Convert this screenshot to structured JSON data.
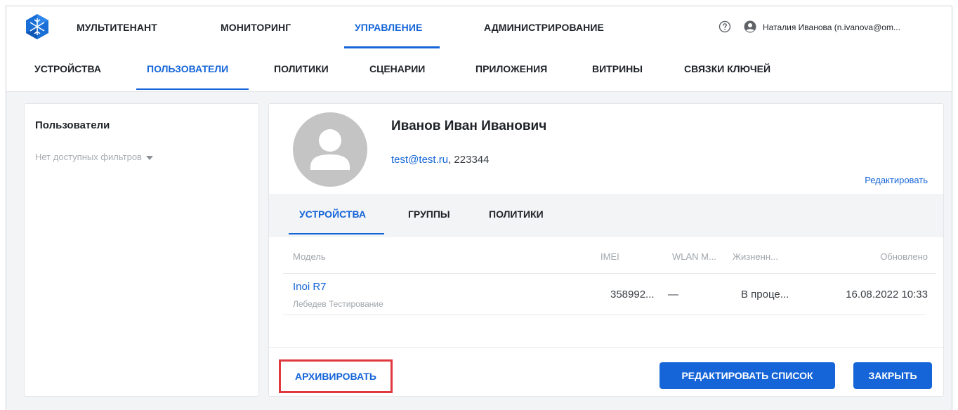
{
  "topnav": {
    "items": [
      "МУЛЬТИТЕНАНТ",
      "МОНИТОРИНГ",
      "УПРАВЛЕНИЕ",
      "АДМИНИСТРИРОВАНИЕ"
    ],
    "active": "УПРАВЛЕНИЕ",
    "user": "Наталия Иванова (n.ivanova@om..."
  },
  "subnav": {
    "items": [
      "УСТРОЙСТВА",
      "ПОЛЬЗОВАТЕЛИ",
      "ПОЛИТИКИ",
      "СЦЕНАРИИ",
      "ПРИЛОЖЕНИЯ",
      "ВИТРИНЫ",
      "СВЯЗКИ КЛЮЧЕЙ"
    ],
    "active": "ПОЛЬЗОВАТЕЛИ"
  },
  "left_panel": {
    "title": "Пользователи",
    "filter": "Нет доступных фильтров"
  },
  "profile": {
    "name": "Иванов Иван Иванович",
    "email": "test@test.ru",
    "contact_rest": ", 223344",
    "edit_link": "Редактировать"
  },
  "tabs": {
    "items": [
      "УСТРОЙСТВА",
      "ГРУППЫ",
      "ПОЛИТИКИ"
    ],
    "active": "УСТРОЙСТВА"
  },
  "table": {
    "headers": [
      "Модель",
      "IMEI",
      "WLAN M...",
      "Жизненн...",
      "Обновлено"
    ],
    "rows": [
      {
        "model": "Inoi R7",
        "owner": "Лебедев Тестирование",
        "imei": "358992...",
        "wlan": "—",
        "lifecycle": "В проце...",
        "updated": "16.08.2022 10:33"
      }
    ]
  },
  "actions": {
    "archive": "АРХИВИРОВАТЬ",
    "edit_list": "РЕДАКТИРОВАТЬ СПИСОК",
    "close": "ЗАКРЫТЬ"
  },
  "colors": {
    "accent": "#1565d8",
    "highlight_border": "#e0383e",
    "background": "#f3f4f6"
  }
}
